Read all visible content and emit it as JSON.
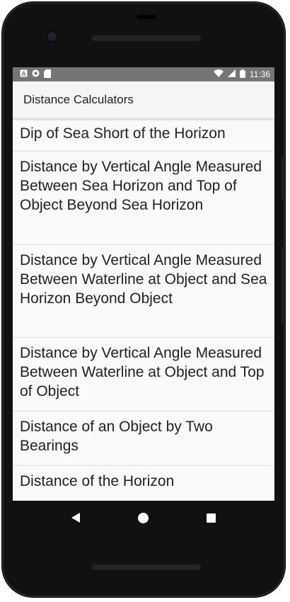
{
  "status_bar": {
    "time": "11:36",
    "left_icons": [
      "a-notification-icon",
      "circle-notification-icon",
      "sd-card-icon"
    ],
    "right_icons": [
      "wifi-icon",
      "signal-icon",
      "battery-icon"
    ]
  },
  "app_bar": {
    "title": "Distance Calculators"
  },
  "list": {
    "items": [
      {
        "label": "Dip of Sea Short of the Horizon"
      },
      {
        "label": "Distance by Vertical Angle Measured Between Sea Horizon and Top of Object Beyond Sea Horizon"
      },
      {
        "label": "Distance by Vertical Angle Measured Between Waterline at Object and Sea Horizon Beyond Object"
      },
      {
        "label": "Distance by Vertical Angle Measured Between Waterline at Object and Top of Object"
      },
      {
        "label": "Distance of an Object by Two Bearings"
      },
      {
        "label": "Distance of the Horizon"
      }
    ]
  },
  "nav_bar": {
    "buttons": [
      "back-icon",
      "home-icon",
      "recents-icon"
    ]
  }
}
